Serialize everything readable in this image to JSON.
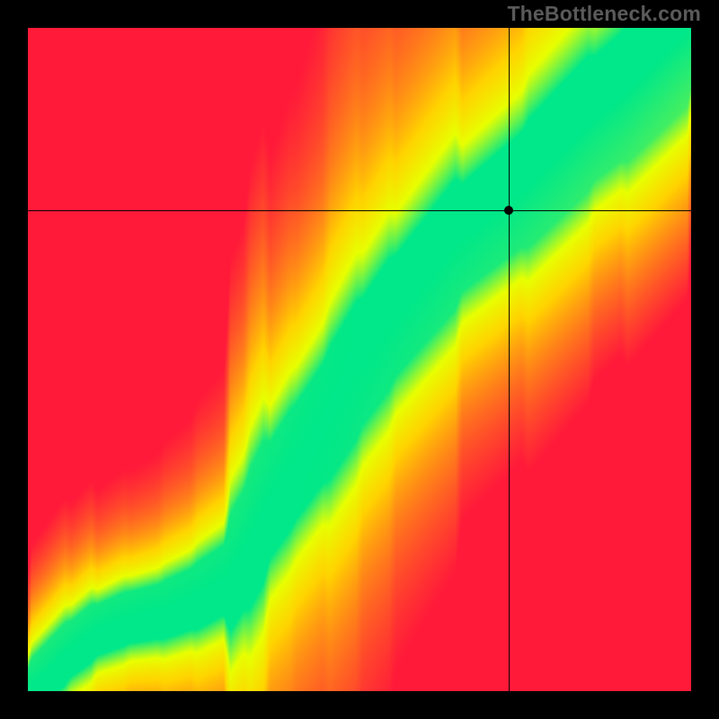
{
  "watermark": "TheBottleneck.com",
  "chart_data": {
    "type": "heatmap",
    "title": "",
    "xlabel": "",
    "ylabel": "",
    "xlim": [
      0,
      100
    ],
    "ylim": [
      0,
      100
    ],
    "grid": false,
    "marker": {
      "x": 72.5,
      "y": 72.5
    },
    "crosshair": {
      "x": 72.5,
      "y": 72.5
    },
    "legend": "none",
    "colormap": {
      "stops": [
        {
          "t": 0.0,
          "color": "#ff1a3a"
        },
        {
          "t": 0.5,
          "color": "#ffd400"
        },
        {
          "t": 0.72,
          "color": "#e8ff00"
        },
        {
          "t": 1.0,
          "color": "#00e88a"
        }
      ]
    },
    "ridge": {
      "description": "Green optimal-fit band: y position of ridge center as a function of x (normalized 0-100). Color of each cell encodes closeness of (x,y) to this ridge.",
      "points": [
        {
          "x": 0,
          "y": 0
        },
        {
          "x": 3,
          "y": 3
        },
        {
          "x": 6,
          "y": 6
        },
        {
          "x": 10,
          "y": 9
        },
        {
          "x": 15,
          "y": 11
        },
        {
          "x": 20,
          "y": 12
        },
        {
          "x": 25,
          "y": 14
        },
        {
          "x": 30,
          "y": 17
        },
        {
          "x": 33,
          "y": 22
        },
        {
          "x": 36,
          "y": 28
        },
        {
          "x": 40,
          "y": 34
        },
        {
          "x": 45,
          "y": 41
        },
        {
          "x": 50,
          "y": 49
        },
        {
          "x": 55,
          "y": 56
        },
        {
          "x": 60,
          "y": 62
        },
        {
          "x": 65,
          "y": 68
        },
        {
          "x": 70,
          "y": 72
        },
        {
          "x": 75,
          "y": 76
        },
        {
          "x": 80,
          "y": 81
        },
        {
          "x": 85,
          "y": 86
        },
        {
          "x": 90,
          "y": 90
        },
        {
          "x": 95,
          "y": 95
        },
        {
          "x": 100,
          "y": 100
        }
      ],
      "band_halfwidth_base": 3.0,
      "band_halfwidth_scale": 5.0
    },
    "field_note": "Value at each (x,y) is a 0-1 fit score; 1 on the ridge (green), fading toward 0 (red) as distance from ridge grows relative to band width."
  }
}
